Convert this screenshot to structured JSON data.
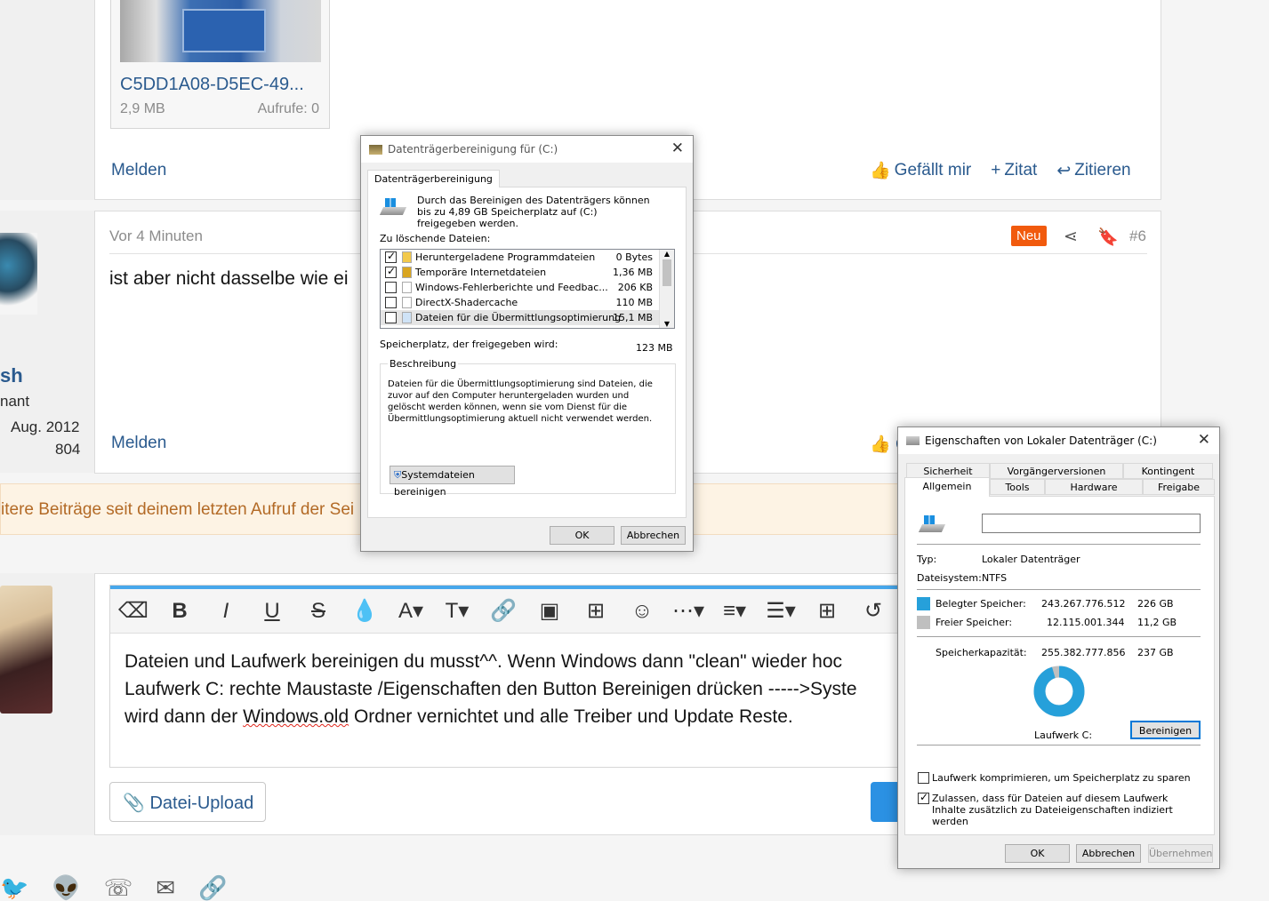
{
  "forum": {
    "attachment": {
      "name": "C5DD1A08-D5EC-49...",
      "size": "2,9 MB",
      "views": "Aufrufe: 0"
    },
    "post1_report": "Melden",
    "post1_actions": {
      "like": "Gefällt mir",
      "quote_plus": "Zitat",
      "reply_quote": "Zitieren"
    },
    "post2": {
      "time": "Vor 4 Minuten",
      "badge": "Neu",
      "number": "#6",
      "text": "ist aber nicht dasselbe wie ei",
      "report": "Melden",
      "like_partial": "C"
    },
    "user": {
      "name": "sh",
      "title": "nant",
      "joined": "Aug. 2012",
      "posts": "804"
    },
    "notice": "itere Beiträge seit deinem letzten Aufruf der Sei",
    "editor": {
      "line1": "Dateien und Laufwerk bereinigen du musst^^. Wenn Windows dann \"clean\" wieder hoc",
      "line2": "Laufwerk C: rechte Maustaste /Eigenschaften den Button Bereinigen drücken ----->Syste",
      "line3_before": "wird dann der ",
      "line3_spell": "Windows.old",
      "line3_after": " Ordner vernichtet und alle Treiber und Update Reste."
    },
    "upload_button": "Datei-Upload"
  },
  "cleanup_dialog": {
    "title": "Datenträgerbereinigung für  (C:)",
    "tab": "Datenträgerbereinigung",
    "intro": "Durch das Bereinigen des Datenträgers können bis zu 4,89 GB Speicherplatz auf  (C:) freigegeben werden.",
    "files_label": "Zu löschende Dateien:",
    "files": [
      {
        "name": "Heruntergeladene Programmdateien",
        "size": "0 Bytes",
        "checked": true
      },
      {
        "name": "Temporäre Internetdateien",
        "size": "1,36 MB",
        "checked": true
      },
      {
        "name": "Windows-Fehlerberichte und Feedbac...",
        "size": "206 KB",
        "checked": false
      },
      {
        "name": "DirectX-Shadercache",
        "size": "110 MB",
        "checked": false
      },
      {
        "name": "Dateien für die Übermittlungsoptimierung",
        "size": "15,1 MB",
        "checked": false
      }
    ],
    "freed_label": "Speicherplatz, der freigegeben wird:",
    "freed_value": "123 MB",
    "description_label": "Beschreibung",
    "description": "Dateien für die Übermittlungsoptimierung sind Dateien, die zuvor auf den Computer heruntergeladen wurden und gelöscht werden können, wenn sie vom Dienst für die Übermittlungsoptimierung aktuell nicht verwendet werden.",
    "system_button": "Systemdateien bereinigen",
    "ok": "OK",
    "cancel": "Abbrechen"
  },
  "props_dialog": {
    "title": "Eigenschaften von Lokaler Datenträger (C:)",
    "tabs_row1": [
      "Sicherheit",
      "Vorgängerversionen",
      "Kontingent"
    ],
    "tabs_row2": [
      "Allgemein",
      "Tools",
      "Hardware",
      "Freigabe"
    ],
    "name_value": "",
    "type_label": "Typ:",
    "type_value": "Lokaler Datenträger",
    "fs_label": "Dateisystem:",
    "fs_value": "NTFS",
    "used_label": "Belegter Speicher:",
    "used_bytes": "243.267.776.512",
    "used_gb": "226 GB",
    "free_label": "Freier Speicher:",
    "free_bytes": "12.115.001.344",
    "free_gb": "11,2 GB",
    "capacity_label": "Speicherkapazität:",
    "capacity_bytes": "255.382.777.856",
    "capacity_gb": "237 GB",
    "used_fraction": 0.953,
    "drive_label": "Laufwerk C:",
    "cleanup_button": "Bereinigen",
    "compress": "Laufwerk komprimieren, um Speicherplatz zu sparen",
    "index": "Zulassen, dass für Dateien auf diesem Laufwerk Inhalte zusätzlich zu Dateieigenschaften indiziert werden",
    "compress_checked": false,
    "index_checked": true,
    "ok": "OK",
    "cancel": "Abbrechen",
    "apply": "Übernehmen",
    "colors": {
      "used": "#26a0da",
      "free": "#bfbfbf"
    }
  }
}
